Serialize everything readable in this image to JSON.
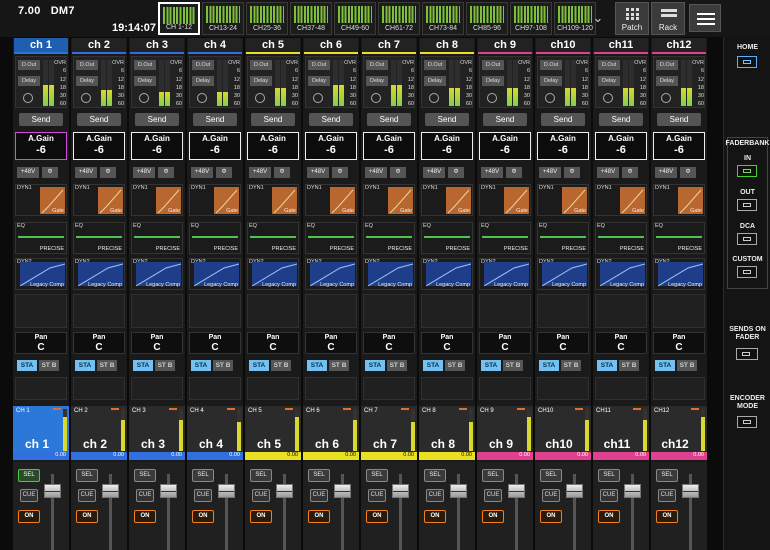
{
  "topbar": {
    "scene_number": "7.00",
    "scene_name": "DM7",
    "time": "19:14:07",
    "banks": [
      "CH 1-12",
      "CH13-24",
      "CH25-36",
      "CH37-48",
      "CH49-60",
      "CH61-72",
      "CH73-84",
      "CH85-96",
      "CH97-108",
      "CH109-120"
    ],
    "selected_bank": 0,
    "patch_label": "Patch",
    "rack_label": "Rack"
  },
  "sidebar": {
    "home": "HOME",
    "faderbank": "FADERBANK",
    "in": "IN",
    "out": "OUT",
    "dca": "DCA",
    "custom": "CUSTOM",
    "sends_on_fader": "SENDS ON FADER",
    "encoder_mode": "ENCODER MODE"
  },
  "labels": {
    "dout": "D.Out",
    "delay": "Delay",
    "ovr": "OVR",
    "scale": [
      "OVR",
      "6",
      "12",
      "18",
      "30",
      "60"
    ],
    "send": "Send",
    "again": "A.Gain",
    "phantom": "+48V",
    "phase": "Φ",
    "dyn1": "DYN1",
    "gate": "Gate",
    "eq": "EQ",
    "precise": "PRECISE",
    "dyn2": "DYN2",
    "legacy": "Legacy Comp",
    "pan": "Pan",
    "sta": "STA",
    "stb": "ST B",
    "sel": "SEL",
    "cue": "CUE",
    "on": "ON"
  },
  "colors": {
    "blue": "#2f6fe0",
    "white": "#e8e8e8",
    "yellow": "#e8e020",
    "pink": "#e04090",
    "selected": "#2b78d8"
  },
  "channels": [
    {
      "name": "ch 1",
      "short": "CH 1",
      "big": "ch 1",
      "gain": "-6",
      "pan": "C",
      "value": "0.00",
      "color": "blue",
      "meter": 0.45,
      "level": 0.8,
      "selected": true
    },
    {
      "name": "ch 2",
      "short": "CH 2",
      "big": "ch 2",
      "gain": "-6",
      "pan": "C",
      "value": "0.00",
      "color": "blue",
      "meter": 0.35,
      "level": 0.75,
      "selected": false
    },
    {
      "name": "ch 3",
      "short": "CH 3",
      "big": "ch 3",
      "gain": "-6",
      "pan": "C",
      "value": "0.00",
      "color": "blue",
      "meter": 0.3,
      "level": 0.75,
      "selected": false
    },
    {
      "name": "ch 4",
      "short": "CH 4",
      "big": "ch 4",
      "gain": "-6",
      "pan": "C",
      "value": "0.00",
      "color": "blue",
      "meter": 0.3,
      "level": 0.7,
      "selected": false
    },
    {
      "name": "ch 5",
      "short": "CH 5",
      "big": "ch 5",
      "gain": "-6",
      "pan": "C",
      "value": "0.00",
      "color": "yellow",
      "meter": 0.4,
      "level": 0.8,
      "selected": false
    },
    {
      "name": "ch 6",
      "short": "CH 6",
      "big": "ch 6",
      "gain": "-6",
      "pan": "C",
      "value": "0.00",
      "color": "yellow",
      "meter": 0.45,
      "level": 0.75,
      "selected": false
    },
    {
      "name": "ch 7",
      "short": "CH 7",
      "big": "ch 7",
      "gain": "-6",
      "pan": "C",
      "value": "0.00",
      "color": "yellow",
      "meter": 0.45,
      "level": 0.7,
      "selected": false
    },
    {
      "name": "ch 8",
      "short": "CH 8",
      "big": "ch 8",
      "gain": "-6",
      "pan": "C",
      "value": "0.00",
      "color": "yellow",
      "meter": 0.4,
      "level": 0.7,
      "selected": false
    },
    {
      "name": "ch 9",
      "short": "CH 9",
      "big": "ch 9",
      "gain": "-6",
      "pan": "C",
      "value": "0.00",
      "color": "pink",
      "meter": 0.4,
      "level": 0.8,
      "selected": false
    },
    {
      "name": "ch10",
      "short": "CH10",
      "big": "ch10",
      "gain": "-6",
      "pan": "C",
      "value": "0.00",
      "color": "pink",
      "meter": 0.4,
      "level": 0.75,
      "selected": false
    },
    {
      "name": "ch11",
      "short": "CH11",
      "big": "ch11",
      "gain": "-6",
      "pan": "C",
      "value": "0.00",
      "color": "pink",
      "meter": 0.4,
      "level": 0.75,
      "selected": false
    },
    {
      "name": "ch12",
      "short": "CH12",
      "big": "ch12",
      "gain": "-6",
      "pan": "C",
      "value": "0.00",
      "color": "pink",
      "meter": 0.4,
      "level": 0.8,
      "selected": false
    }
  ]
}
